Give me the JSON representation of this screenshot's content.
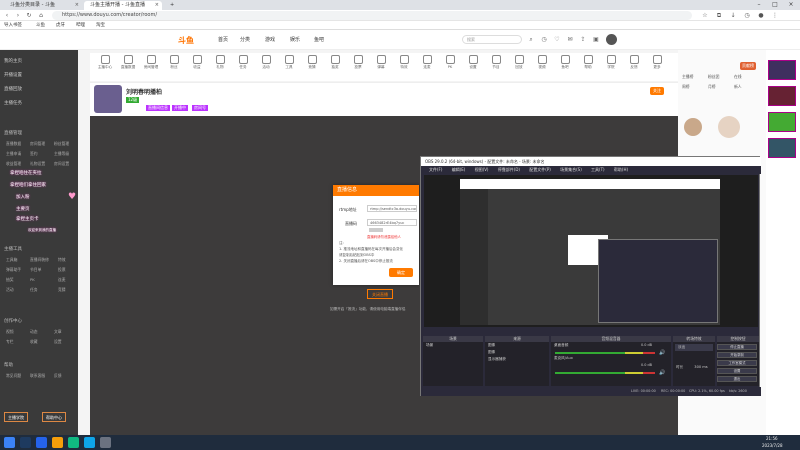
{
  "browser": {
    "tabs": [
      {
        "label": "斗鱼分类目录 - 斗鱼"
      },
      {
        "label": "斗鱼主播开播 - 斗鱼直播"
      }
    ],
    "new_tab": "+",
    "url": "https://www.douyu.com/creator/room/",
    "bookmarks": [
      "导入书签",
      "斗鱼",
      "虎牙",
      "哔哩",
      "淘宝"
    ]
  },
  "site": {
    "logo": "斗鱼",
    "nav": [
      "首页",
      "分类",
      "游戏",
      "娱乐",
      "鱼吧"
    ],
    "search_placeholder": "搜索"
  },
  "sidebar": {
    "top_items": [
      "我的主页",
      "开播设置",
      "直播回放",
      "主播任务"
    ],
    "section1_title": "直播管理",
    "section1_rows": [
      [
        "直播数据",
        "房间管理",
        "粉丝管理"
      ],
      [
        "主播申请",
        "签约",
        "主播等级"
      ],
      [
        "收益管理",
        "礼物设置",
        "房间设置"
      ],
      [
        "开播提醒",
        "工具",
        "更多"
      ]
    ],
    "section2_title": "主播工具",
    "section2_rows": [
      [
        "工具箱",
        "直播间装修",
        "特效"
      ],
      [
        "弹幕助手",
        "节目单",
        "投票"
      ],
      [
        "抽奖",
        "PK",
        "连麦"
      ],
      [
        "活动",
        "任务",
        "竞猜"
      ]
    ],
    "section3_title": "创作中心",
    "section3_rows": [
      [
        "视频",
        "动态",
        "文章"
      ],
      [
        "专栏",
        "收藏",
        "设置"
      ]
    ],
    "section4_title": "帮助",
    "section4_rows": [
      [
        "常见问题",
        "联系客服",
        "反馈"
      ]
    ],
    "footer_buttons": [
      "主播学院",
      "帮助中心"
    ]
  },
  "toolbar": {
    "items": [
      "主播中心",
      "直播数据",
      "房间管理",
      "粉丝",
      "收益",
      "礼物",
      "任务",
      "活动",
      "工具",
      "竞猜",
      "抽奖",
      "投票",
      "弹幕",
      "特效",
      "连麦",
      "PK",
      "设置",
      "节目",
      "回放",
      "视频",
      "鱼吧",
      "帮助",
      "学院",
      "反馈",
      "更多"
    ]
  },
  "anchor": {
    "name": "刘明春明播柏",
    "level": "12级",
    "tags": [
      "直播间信息",
      "开播中",
      "房间号"
    ],
    "follow": "关注"
  },
  "modal": {
    "title": "直播信息",
    "rtmp_label": "rtmp地址",
    "rtmp_value": "rtmp://sendtc3a.douyu.com/live",
    "key_label": "直播码",
    "key_value": "4663482rE4bq7yuc",
    "warning": "直播码请勿泄露给他人",
    "note_title": "注:",
    "notes": [
      "1. 推流地址和直播码在每次开播后会变化",
      "请复制后粘贴到OBS中",
      "2. 关闭直播后请在OBS中停止推流"
    ],
    "confirm": "确定"
  },
  "stage": {
    "button": "关闭直播",
    "note": "如需开启「推流」功能，请使用电脑端直播伴侣"
  },
  "sticker": {
    "lines": [
      "拿捏咱住在夹拉",
      "拿捏咱们拿住回家",
      "加入粉",
      "主要页",
      "拿捏主页卡",
      "欢迎来到我的直播"
    ]
  },
  "rightpanel": {
    "badge": "贡献榜",
    "labels": [
      "主播榜",
      "粉丝团",
      "在线",
      "周榜",
      "月榜",
      "新人"
    ]
  },
  "obs": {
    "title": "OBS 29.0.2 (64-bit, windows) - 配置文件: 未命名 - 场景: 未命名",
    "menu": [
      "文件(F)",
      "编辑(E)",
      "视图(V)",
      "停靠部件(D)",
      "配置文件(P)",
      "场景集合(S)",
      "工具(T)",
      "帮助(H)"
    ],
    "docks": {
      "scenes": "场景",
      "sources": "来源",
      "mixer": "音频混音器",
      "transitions": "转场特效",
      "controls": "控制按钮"
    },
    "scene_items": [
      "场景"
    ],
    "source_items": [
      "图像",
      "图像",
      "显示器捕获"
    ],
    "mixer_items": [
      "桌面音频",
      "麦克风/Aux"
    ],
    "mixer_levels": [
      "0.0 dB",
      "0.0 dB"
    ],
    "transition": "淡出",
    "duration_label": "时长",
    "duration_value": "300 ms",
    "controls": [
      "停止直播",
      "开始录制",
      "工作室模式",
      "设置",
      "退出"
    ],
    "status": [
      "LIVE: 00:00:00",
      "REC: 00:00:00",
      "CPU: 2.1%, 60.00 fps",
      "kb/s: 2600"
    ]
  },
  "taskbar": {
    "time": "21:56",
    "date": "2023/7/28"
  },
  "colors": {
    "accent": "#ff7a00",
    "obs_bg": "#2b2a3a",
    "sidebar_bg": "#3a3a3a"
  }
}
